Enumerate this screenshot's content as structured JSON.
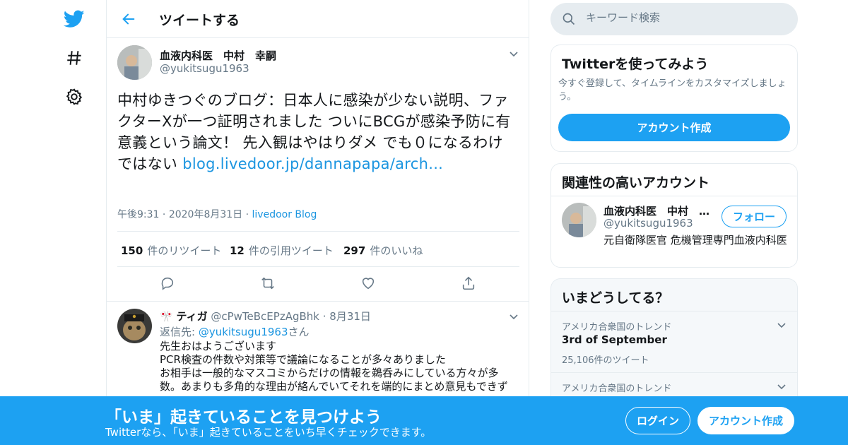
{
  "header": {
    "title": "ツイートする"
  },
  "tweet": {
    "author_name": "血液内科医　中村　幸嗣",
    "author_handle": "@yukitsugu1963",
    "text": "中村ゆきつぐのブログ：日本人に感染が少ない説明、ファクターXが一つ証明されました ついにBCGが感染予防に有意義という論文！ 先入観はやはりダメ でも０になるわけではない ",
    "link": "blog.livedoor.jp/dannapapa/arch...",
    "time": "午後9:31",
    "date": "2020年8月31日",
    "source": "livedoor Blog",
    "stats": {
      "retweets": "150",
      "retweets_label": "件のリツイート",
      "quotes": "12",
      "quotes_label": "件の引用ツイート",
      "likes": "297",
      "likes_label": "件のいいね"
    }
  },
  "reply": {
    "author_name": "ティガ",
    "author_handle": "@cPwTeBcEPzAgBhk",
    "date": "8月31日",
    "reply_to_label": "返信先:",
    "reply_to_handle": "@yukitsugu1963",
    "reply_to_suffix": "さん",
    "body_lines": [
      "先生おはようございます",
      "PCR検査の件数や対策等で議論になることが多々ありました",
      "お相手は一般的なマスコミからだけの情報を鵜呑みにしている方々が多数。あまりも多角的な理由が絡んでいてそれを端的にまとめ意見もできず"
    ]
  },
  "search": {
    "placeholder": "キーワード検索"
  },
  "signup_card": {
    "title": "Twitterを使ってみよう",
    "description": "今すぐ登録して、タイムラインをカスタマイズしましょう。",
    "button": "アカウント作成"
  },
  "related_card": {
    "title": "関連性の高いアカウント",
    "name": "血液内科医　中村　…",
    "handle": "@yukitsugu1963",
    "follow": "フォロー",
    "bio": "元自衛隊医官 危機管理専門血液内科医"
  },
  "trends_card": {
    "title": "いまどうしてる？",
    "items": [
      {
        "context": "アメリカ合衆国のトレンド",
        "name": "3rd of September",
        "count": "25,106件のツイート"
      },
      {
        "context": "アメリカ合衆国のトレンド"
      }
    ]
  },
  "banner": {
    "title": "「いま」起きていることを見つけよう",
    "subtitle": "Twitterなら、「いま」起きていることをいち早くチェックできます。",
    "login": "ログイン",
    "signup": "アカウント作成"
  },
  "colors": {
    "brand": "#1da1f2",
    "link": "#1b95e0",
    "muted": "#657786"
  },
  "icons": [
    "twitter-logo-icon",
    "hashtag-icon",
    "gear-icon",
    "back-arrow-icon",
    "chevron-down-icon",
    "reply-icon",
    "retweet-icon",
    "like-icon",
    "share-icon",
    "search-icon"
  ]
}
